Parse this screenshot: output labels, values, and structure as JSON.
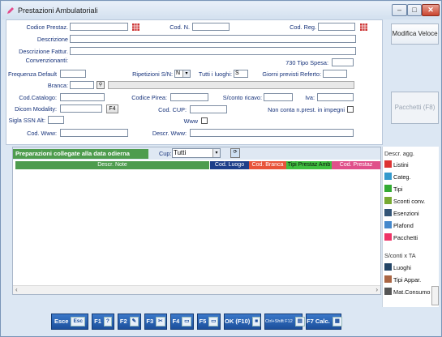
{
  "window": {
    "title": "Prestazioni Ambulatoriali",
    "controls": {
      "minimize": "–",
      "maximize": "□",
      "close": "✕"
    }
  },
  "form": {
    "codice_prestaz_label": "Codice Prestaz.",
    "cod_n_label": "Cod. N.",
    "cod_reg_label": "Cod. Reg.",
    "descrizione_label": "Descrizione",
    "descrizione_fattur_label": "Descrizione Fattur.",
    "convenzionanti_label": "Convenzionanti:",
    "tipo_spesa_label": "730 Tipo Spesa:",
    "frequenza_label": "Frequenza Default",
    "ripetizioni_label": "Ripetizioni S/N:",
    "ripetizioni_value": "N",
    "tutti_luoghi_label": "Tutti i luoghi:",
    "tutti_luoghi_value": "S",
    "giorni_label": "Giorni previsti Referto:",
    "branca_label": "Branca:",
    "cod_catalogo_label": "Cod.Catalogo:",
    "codice_pirea_label": "Codice Pirea:",
    "sconto_ricavo_label": "S/conto ricavo:",
    "iva_label": "Iva:",
    "dicom_label": "Dicom Modality:",
    "f4_label": "F4",
    "cod_cup_label": "Cod. CUP:",
    "non_conta_label": "Non conta n.prest. in impegni",
    "sigla_ssn_label": "Sigla SSN Alt:",
    "www_label": "Www",
    "cod_www_label": "Cod. Www:",
    "descr_www_label": "Descr. Www:"
  },
  "side_buttons": {
    "modifica_veloce": "Modifica Veloce",
    "pacchetti_f8": "Pacchetti (F8)"
  },
  "list": {
    "title": "Preparazioni collegate alla data odierna",
    "cup_label": "Cup:",
    "cup_value": "Tutti",
    "columns": [
      {
        "label": "Descr. Note",
        "color": "#4e9c4e"
      },
      {
        "label": "Cod. Luogo",
        "color": "#1d3f8a"
      },
      {
        "label": "Cod. Branca",
        "color": "#e8543a"
      },
      {
        "label": "Tipi Prestaz Amb",
        "color": "#3fbf3f"
      },
      {
        "label": "Cod. Prestaz",
        "color": "#e0508a"
      }
    ]
  },
  "right_menu": {
    "descr_agg": "Descr. agg.",
    "items1": [
      {
        "label": "Listini",
        "icon": "pencil-red-icon",
        "color": "#d33"
      },
      {
        "label": "Categ.",
        "icon": "pencil-cyan-icon",
        "color": "#39c"
      },
      {
        "label": "Tipi",
        "icon": "pencil-green-icon",
        "color": "#3a3"
      },
      {
        "label": "Sconti conv.",
        "icon": "percent-icon",
        "color": "#7a3"
      },
      {
        "label": "Esenzioni",
        "icon": "filter-icon",
        "color": "#357"
      },
      {
        "label": "Plafond",
        "icon": "chart-icon",
        "color": "#48c"
      },
      {
        "label": "Pacchetti",
        "icon": "pencil-pink-icon",
        "color": "#e36"
      }
    ],
    "sconti_x_ta": "S/conti x TA",
    "items2": [
      {
        "label": "Luoghi",
        "icon": "building-icon",
        "color": "#246"
      },
      {
        "label": "Tipi Appar.",
        "icon": "device-icon",
        "color": "#a64"
      },
      {
        "label": "Mat.Consumo",
        "icon": "tools-icon",
        "color": "#555"
      }
    ]
  },
  "bottom_buttons": [
    {
      "label": "Esce",
      "key": "Esc"
    },
    {
      "label": "F1",
      "key": "?"
    },
    {
      "label": "F2",
      "key": "✎"
    },
    {
      "label": "F3",
      "key": "✂"
    },
    {
      "label": "F4",
      "key": "▭"
    },
    {
      "label": "F5",
      "key": "▭"
    },
    {
      "label": "OK (F10)",
      "key": "■"
    },
    {
      "label": "Ctrl+Shift F12",
      "key": "▤"
    },
    {
      "label": "F7 Calc.",
      "key": "▦"
    }
  ]
}
